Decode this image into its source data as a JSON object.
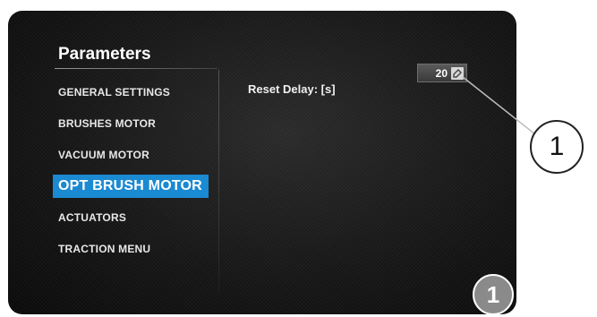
{
  "panel": {
    "title": "Parameters"
  },
  "menu": {
    "items": [
      {
        "label": "GENERAL SETTINGS",
        "active": false
      },
      {
        "label": "BRUSHES MOTOR",
        "active": false
      },
      {
        "label": "VACUUM MOTOR",
        "active": false
      },
      {
        "label": "OPT BRUSH MOTOR",
        "active": true
      },
      {
        "label": "ACTUATORS",
        "active": false
      },
      {
        "label": "TRACTION MENU",
        "active": false
      }
    ]
  },
  "parameter": {
    "label": "Reset Delay: [s]",
    "value": "20",
    "edit_icon": "edit-icon"
  },
  "callout": {
    "number": "1"
  },
  "page_badge": {
    "number": "1"
  },
  "colors": {
    "active_item": "#1a8ad2",
    "screen_bg": "#151515",
    "badge": "#8a8a8a"
  }
}
